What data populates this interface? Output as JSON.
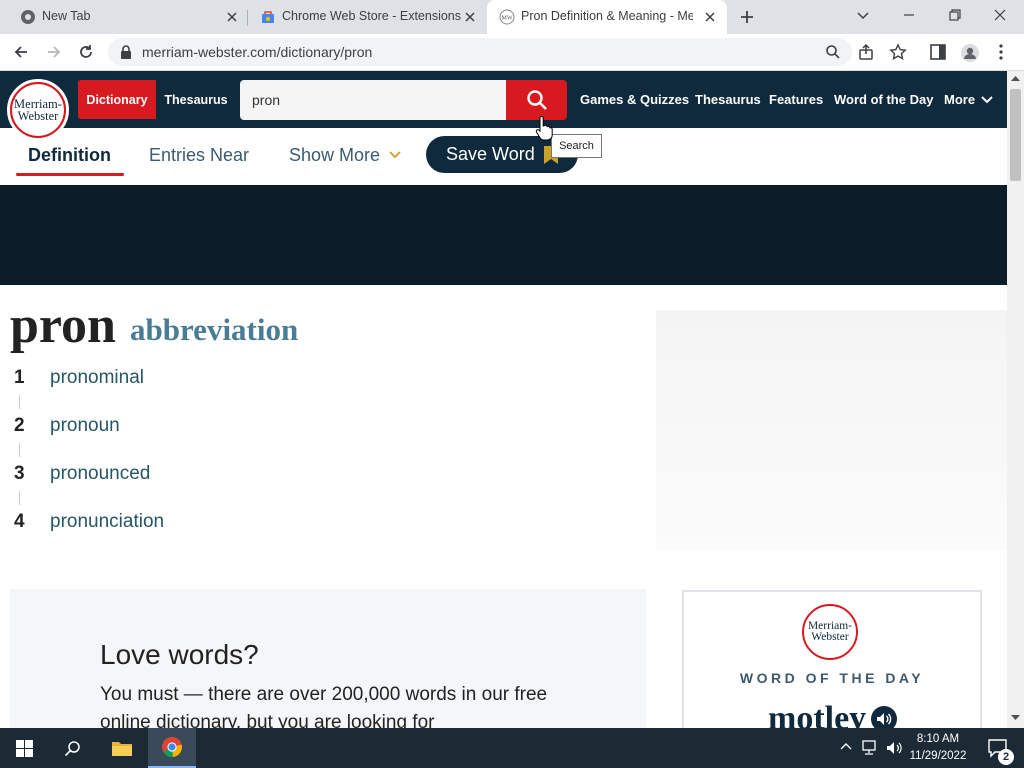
{
  "browser": {
    "tabs": [
      {
        "title": "New Tab",
        "favicon": "chrome-icon"
      },
      {
        "title": "Chrome Web Store - Extensions",
        "favicon": "webstore-icon"
      },
      {
        "title": "Pron Definition & Meaning - Me",
        "favicon": "mw-icon",
        "active": true
      }
    ],
    "url": "merriam-webster.com/dictionary/pron"
  },
  "site": {
    "logo_line1": "Merriam-",
    "logo_line2": "Webster",
    "dictionary_tab": "Dictionary",
    "thesaurus_tab": "Thesaurus",
    "search_value": "pron",
    "nav": [
      "Games & Quizzes",
      "Thesaurus",
      "Features",
      "Word of the Day",
      "More"
    ],
    "search_tooltip": "Search",
    "colors": {
      "navy": "#0f2a3d",
      "red": "#d71920",
      "teal": "#265667"
    }
  },
  "subnav": {
    "definition": "Definition",
    "entries_near": "Entries Near",
    "show_more": "Show More",
    "save_word": "Save Word"
  },
  "entry": {
    "headword": "pron",
    "function_label": "abbreviation",
    "senses": [
      {
        "num": "1",
        "text": "pronominal"
      },
      {
        "num": "2",
        "text": "pronoun"
      },
      {
        "num": "3",
        "text": "pronounced"
      },
      {
        "num": "4",
        "text": "pronunciation"
      }
    ]
  },
  "promo": {
    "title": "Love words?",
    "body": "You must — there are over 200,000 words in our free online dictionary, but you are looking for"
  },
  "wotd": {
    "logo_line1": "Merriam-",
    "logo_line2": "Webster",
    "label": "WORD OF THE DAY",
    "word": "motley"
  },
  "taskbar": {
    "time": "8:10 AM",
    "date": "11/29/2022",
    "notifications": "2"
  }
}
